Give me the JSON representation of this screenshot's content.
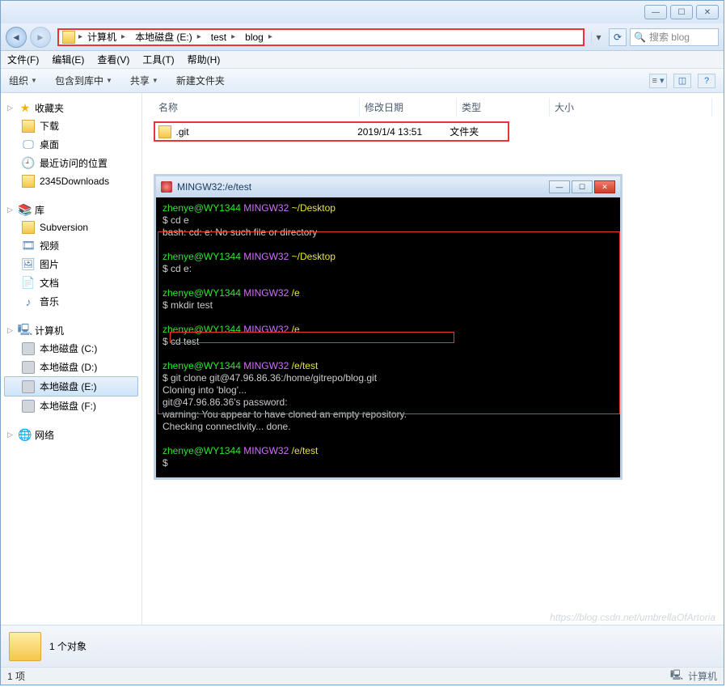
{
  "titlebar": {
    "min": "—",
    "max": "☐",
    "close": "✕"
  },
  "nav": {
    "breadcrumb": [
      "计算机",
      "本地磁盘 (E:)",
      "test",
      "blog"
    ],
    "refresh": "⟳",
    "search_placeholder": "搜索 blog"
  },
  "menus": [
    "文件(F)",
    "编辑(E)",
    "查看(V)",
    "工具(T)",
    "帮助(H)"
  ],
  "toolbar": {
    "organize": "组织",
    "include": "包含到库中",
    "share": "共享",
    "newfolder": "新建文件夹"
  },
  "sidebar": {
    "favorites": {
      "label": "收藏夹",
      "items": [
        "下载",
        "桌面",
        "最近访问的位置",
        "2345Downloads"
      ]
    },
    "libraries": {
      "label": "库",
      "items": [
        "Subversion",
        "视频",
        "图片",
        "文档",
        "音乐"
      ]
    },
    "computer": {
      "label": "计算机",
      "items": [
        "本地磁盘 (C:)",
        "本地磁盘 (D:)",
        "本地磁盘 (E:)",
        "本地磁盘 (F:)"
      ],
      "selected": 2
    },
    "network": {
      "label": "网络"
    }
  },
  "columns": {
    "name": "名称",
    "date": "修改日期",
    "type": "类型",
    "size": "大小"
  },
  "file": {
    "name": ".git",
    "date": "2019/1/4 13:51",
    "type": "文件夹"
  },
  "terminal": {
    "title": "MINGW32:/e/test",
    "lines": [
      {
        "user": "zhenye@WY1344",
        "env": "MINGW32",
        "path": "~/Desktop"
      },
      {
        "cmd": "$ cd e"
      },
      {
        "out": "bash: cd: e: No such file or directory"
      },
      {
        "blank": true
      },
      {
        "user": "zhenye@WY1344",
        "env": "MINGW32",
        "path": "~/Desktop"
      },
      {
        "cmd": "$ cd e:"
      },
      {
        "blank": true
      },
      {
        "user": "zhenye@WY1344",
        "env": "MINGW32",
        "path": "/e"
      },
      {
        "cmd": "$ mkdir test"
      },
      {
        "blank": true
      },
      {
        "user": "zhenye@WY1344",
        "env": "MINGW32",
        "path": "/e"
      },
      {
        "cmd": "$ cd test"
      },
      {
        "blank": true
      },
      {
        "user": "zhenye@WY1344",
        "env": "MINGW32",
        "path": "/e/test"
      },
      {
        "cmd": "$ git clone git@47.96.86.36:/home/gitrepo/blog.git"
      },
      {
        "out": "Cloning into 'blog'..."
      },
      {
        "out": "git@47.96.86.36's password:"
      },
      {
        "out": "warning: You appear to have cloned an empty repository."
      },
      {
        "out": "Checking connectivity... done."
      },
      {
        "blank": true
      },
      {
        "user": "zhenye@WY1344",
        "env": "MINGW32",
        "path": "/e/test"
      },
      {
        "cmd": "$"
      }
    ]
  },
  "status": {
    "count": "1 个对象",
    "items": "1 项",
    "computer": "计算机"
  },
  "watermark": "https://blog.csdn.net/umbrellaOfArtoria"
}
